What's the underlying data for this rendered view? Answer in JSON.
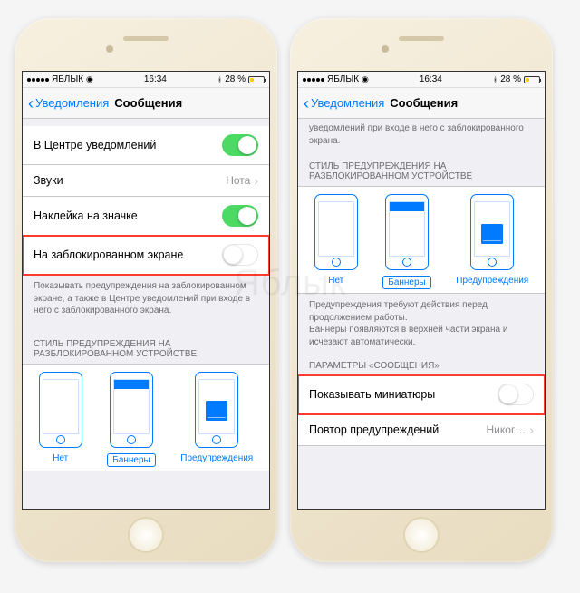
{
  "watermark": "Яблык",
  "statusBar": {
    "carrier": "ЯБЛЫК",
    "time": "16:34",
    "batteryPercent": "28 %"
  },
  "nav": {
    "back": "Уведомления",
    "title": "Сообщения"
  },
  "left": {
    "rows": {
      "notificationCenter": "В Центре уведомлений",
      "sounds": "Звуки",
      "soundsValue": "Нота",
      "badge": "Наклейка на значке",
      "lockScreen": "На заблокированном экране"
    },
    "footer": "Показывать предупреждения на заблокированном экране, а также в Центре уведомлений при входе в него с заблокированного экрана.",
    "sectionHeader": "СТИЛЬ ПРЕДУПРЕЖДЕНИЯ НА РАЗБЛОКИРОВАННОМ УСТРОЙСТВЕ",
    "styles": {
      "none": "Нет",
      "banners": "Баннеры",
      "alerts": "Предупреждения"
    }
  },
  "right": {
    "topFooter": "уведомлений при входе в него с заблокированного экрана.",
    "sectionHeader": "СТИЛЬ ПРЕДУПРЕЖДЕНИЯ НА РАЗБЛОКИРОВАННОМ УСТРОЙСТВЕ",
    "styles": {
      "none": "Нет",
      "banners": "Баннеры",
      "alerts": "Предупреждения"
    },
    "midFooter": "Предупреждения требуют действия перед продолжением работы.\nБаннеры появляются в верхней части экрана и исчезают автоматически.",
    "paramsHeader": "ПАРАМЕТРЫ «СООБЩЕНИЯ»",
    "rows": {
      "showPreviews": "Показывать миниатюры",
      "repeat": "Повтор предупреждений",
      "repeatValue": "Никог…"
    }
  }
}
